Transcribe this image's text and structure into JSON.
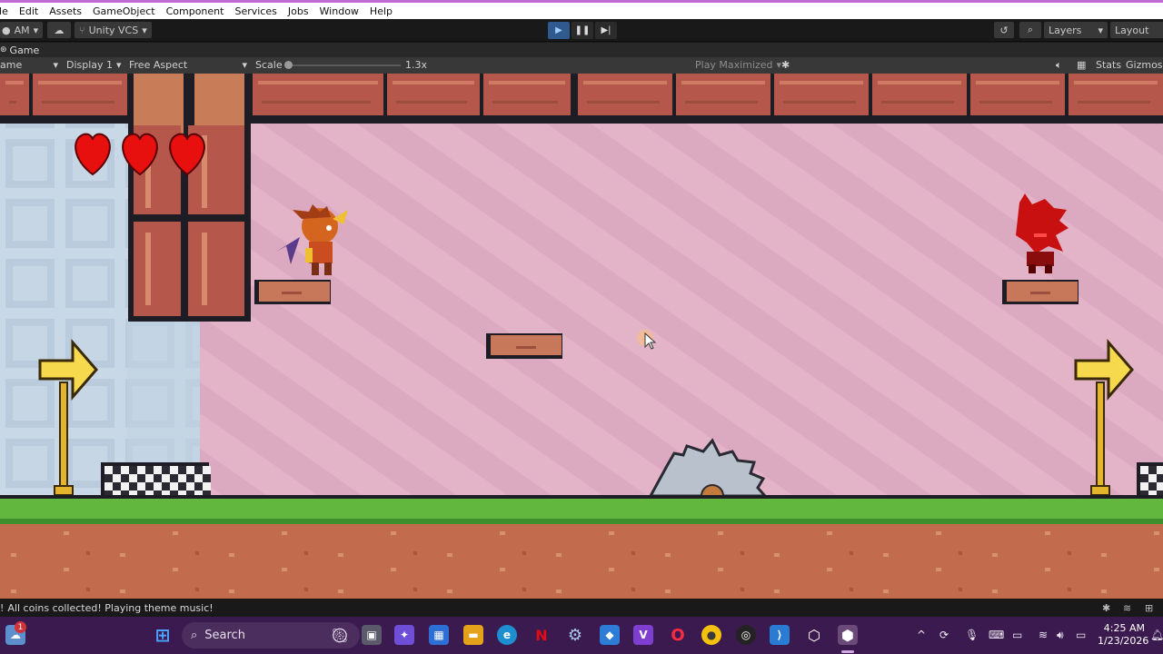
{
  "menu": [
    "ile",
    "Edit",
    "Assets",
    "GameObject",
    "Component",
    "Services",
    "Jobs",
    "Window",
    "Help"
  ],
  "toolbar": {
    "account": "AM",
    "vcs": "Unity VCS",
    "layers": "Layers",
    "layout": "Layout"
  },
  "game_tab": {
    "label": "Game"
  },
  "game_bar": {
    "view_select": "ame",
    "display": "Display 1",
    "aspect": "Free Aspect",
    "scale_label": "Scale",
    "scale_value": "1.3x",
    "scale_fraction": 0.02,
    "play_mode": "Play Maximized",
    "stats": "Stats",
    "gizmos": "Gizmos"
  },
  "game": {
    "hearts_count": 3,
    "colors": {
      "sky": "#e3b3c8",
      "brick": "#b5574a",
      "grass": "#62b73f",
      "dirt": "#c26b4d"
    }
  },
  "status": {
    "message": "All coins collected! Playing theme music!"
  },
  "taskbar": {
    "search_placeholder": "Search",
    "notification_count": "1",
    "time": "4:25 AM",
    "date": "1/23/2026"
  }
}
